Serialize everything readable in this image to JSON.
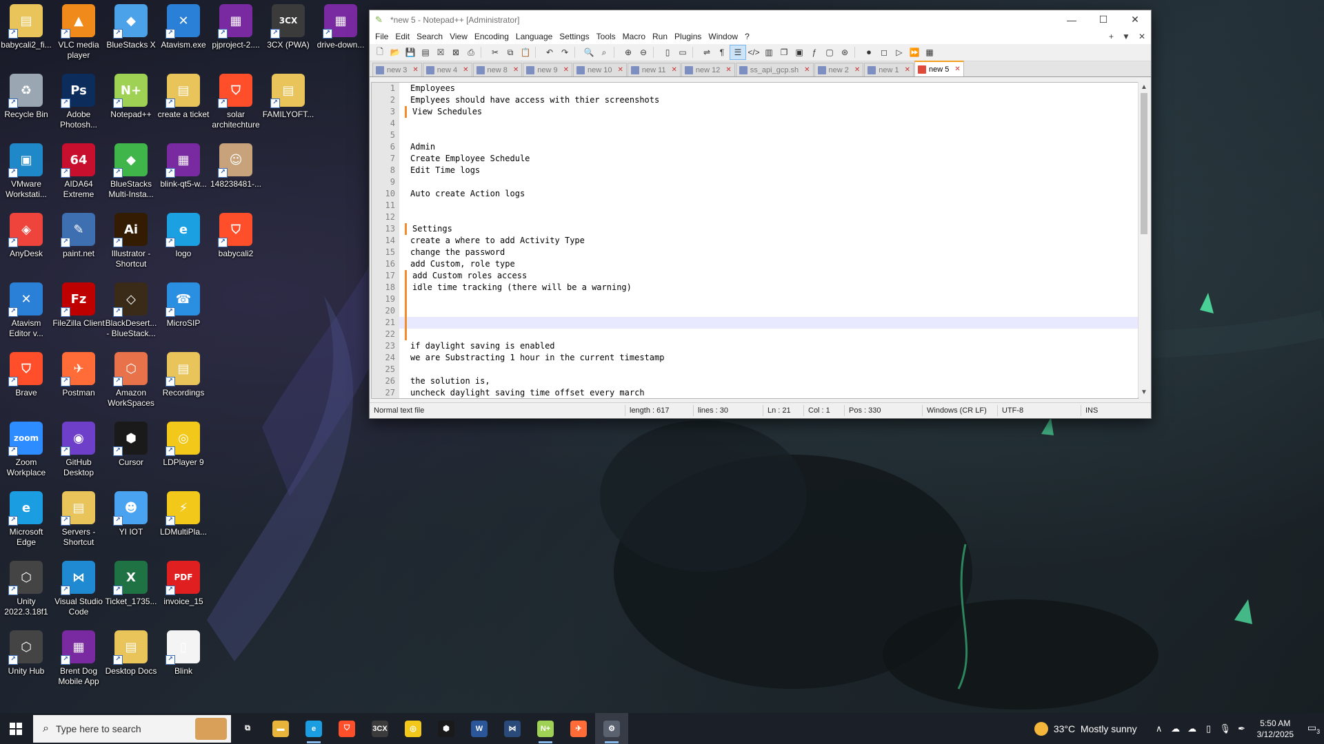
{
  "desktop": {
    "icons": [
      {
        "label": "babycali2_fi...",
        "color": "#e8c45a",
        "glyph": "▤"
      },
      {
        "label": "VLC media player",
        "color": "#f08a1a",
        "glyph": "▲"
      },
      {
        "label": "BlueStacks X",
        "color": "#4ba2e8",
        "glyph": "◆"
      },
      {
        "label": "Atavism.exe",
        "color": "#2a7fd6",
        "glyph": "✕"
      },
      {
        "label": "pjproject-2....",
        "color": "#7a2aa0",
        "glyph": "▦"
      },
      {
        "label": "3CX (PWA)",
        "color": "#3b3b3b",
        "glyph": "3CX"
      },
      {
        "label": "drive-down...",
        "color": "#7a2aa0",
        "glyph": "▦"
      },
      {
        "label": "Recycle Bin",
        "color": "#9aa7b2",
        "glyph": "♻"
      },
      {
        "label": "Adobe Photosh...",
        "color": "#0c2d5c",
        "glyph": "Ps"
      },
      {
        "label": "Notepad++",
        "color": "#9fd154",
        "glyph": "N+"
      },
      {
        "label": "create a ticket",
        "color": "#e8c45a",
        "glyph": "▤"
      },
      {
        "label": "solar architechture",
        "color": "#ff4f2a",
        "glyph": "⛉"
      },
      {
        "label": "FAMILYOFT...",
        "color": "#e8c45a",
        "glyph": "▤"
      },
      {
        "label": "VMware Workstati...",
        "color": "#1f88c9",
        "glyph": "▣"
      },
      {
        "label": "AIDA64 Extreme",
        "color": "#c8102e",
        "glyph": "64"
      },
      {
        "label": "BlueStacks Multi-Insta...",
        "color": "#3fb54a",
        "glyph": "◆"
      },
      {
        "label": "blink-qt5-w...",
        "color": "#7a2aa0",
        "glyph": "▦"
      },
      {
        "label": "148238481-...",
        "color": "#c8a27a",
        "glyph": "☺"
      },
      {
        "label": "AnyDesk",
        "color": "#ef443b",
        "glyph": "◈"
      },
      {
        "label": "paint.net",
        "color": "#3e6fb0",
        "glyph": "✎"
      },
      {
        "label": "Illustrator - Shortcut",
        "color": "#331c02",
        "glyph": "Ai"
      },
      {
        "label": "logo",
        "color": "#1ba1e2",
        "glyph": "e"
      },
      {
        "label": "babycali2",
        "color": "#ff4f2a",
        "glyph": "⛉"
      },
      {
        "label": "Atavism Editor v...",
        "color": "#2a7fd6",
        "glyph": "✕"
      },
      {
        "label": "FileZilla Client",
        "color": "#bf0000",
        "glyph": "Fz"
      },
      {
        "label": "BlackDesert... - BlueStack...",
        "color": "#3a2a18",
        "glyph": "◇"
      },
      {
        "label": "MicroSIP",
        "color": "#2a8fe0",
        "glyph": "☎"
      },
      {
        "label": "Brave",
        "color": "#ff4f2a",
        "glyph": "⛉"
      },
      {
        "label": "Postman",
        "color": "#ff6c37",
        "glyph": "✈"
      },
      {
        "label": "Amazon WorkSpaces",
        "color": "#e8734a",
        "glyph": "⬡"
      },
      {
        "label": "Recordings",
        "color": "#e8c45a",
        "glyph": "▤"
      },
      {
        "label": "Zoom Workplace",
        "color": "#2d8cff",
        "glyph": "zoom"
      },
      {
        "label": "GitHub Desktop",
        "color": "#6e40c9",
        "glyph": "◉"
      },
      {
        "label": "Cursor",
        "color": "#1a1a1a",
        "glyph": "⬢"
      },
      {
        "label": "LDPlayer 9",
        "color": "#f2c81a",
        "glyph": "◎"
      },
      {
        "label": "Microsoft Edge",
        "color": "#1b9de2",
        "glyph": "e"
      },
      {
        "label": "Servers - Shortcut",
        "color": "#e8c45a",
        "glyph": "▤"
      },
      {
        "label": "YI IOT",
        "color": "#4aa3f0",
        "glyph": "☻"
      },
      {
        "label": "LDMultiPla...",
        "color": "#f2c81a",
        "glyph": "⚡"
      },
      {
        "label": "Unity 2022.3.18f1",
        "color": "#444",
        "glyph": "⬡"
      },
      {
        "label": "Visual Studio Code",
        "color": "#1f8ad2",
        "glyph": "⋈"
      },
      {
        "label": "Ticket_1735...",
        "color": "#1f7244",
        "glyph": "X"
      },
      {
        "label": "invoice_15",
        "color": "#e02020",
        "glyph": "PDF"
      },
      {
        "label": "Unity Hub",
        "color": "#444",
        "glyph": "⬡"
      },
      {
        "label": "Brent Dog Mobile App",
        "color": "#7a2aa0",
        "glyph": "▦"
      },
      {
        "label": "Desktop Docs",
        "color": "#e8c45a",
        "glyph": "▤"
      },
      {
        "label": "Blink",
        "color": "#f4f4f4",
        "glyph": "▯"
      }
    ]
  },
  "window": {
    "title": "*new 5 - Notepad++ [Administrator]",
    "menu": [
      "File",
      "Edit",
      "Search",
      "View",
      "Encoding",
      "Language",
      "Settings",
      "Tools",
      "Macro",
      "Run",
      "Plugins",
      "Window",
      "?"
    ],
    "menu_right": [
      "+",
      "▼",
      "✕"
    ],
    "tabs": [
      {
        "label": "new 3",
        "active": false
      },
      {
        "label": "new 4",
        "active": false
      },
      {
        "label": "new 8",
        "active": false
      },
      {
        "label": "new 9",
        "active": false
      },
      {
        "label": "new 10",
        "active": false
      },
      {
        "label": "new 11",
        "active": false
      },
      {
        "label": "new 12",
        "active": false
      },
      {
        "label": "ss_api_gcp.sh",
        "active": false
      },
      {
        "label": "new 2",
        "active": false
      },
      {
        "label": "new 1",
        "active": false
      },
      {
        "label": "new 5",
        "active": true
      }
    ],
    "lines": [
      {
        "n": "1",
        "text": "Employees",
        "changed": false
      },
      {
        "n": "2",
        "text": "Emplyees should have access with thier screenshots",
        "changed": false
      },
      {
        "n": "3",
        "text": "View Schedules",
        "changed": true
      },
      {
        "n": "4",
        "text": "",
        "changed": false
      },
      {
        "n": "5",
        "text": "",
        "changed": false
      },
      {
        "n": "6",
        "text": "Admin",
        "changed": false
      },
      {
        "n": "7",
        "text": "Create Employee Schedule",
        "changed": false
      },
      {
        "n": "8",
        "text": "Edit Time logs",
        "changed": false
      },
      {
        "n": "9",
        "text": "",
        "changed": false
      },
      {
        "n": "10",
        "text": "Auto create Action logs",
        "changed": false
      },
      {
        "n": "11",
        "text": "",
        "changed": false
      },
      {
        "n": "12",
        "text": "",
        "changed": false
      },
      {
        "n": "13",
        "text": "Settings",
        "changed": true
      },
      {
        "n": "14",
        "text": "create a where to add Activity Type",
        "changed": false
      },
      {
        "n": "15",
        "text": "change the password",
        "changed": false
      },
      {
        "n": "16",
        "text": "add Custom, role type",
        "changed": false
      },
      {
        "n": "17",
        "text": "add Custom roles access",
        "changed": true
      },
      {
        "n": "18",
        "text": "idle time tracking (there will be a warning)",
        "changed": true
      },
      {
        "n": "19",
        "text": "",
        "changed": true
      },
      {
        "n": "20",
        "text": "",
        "changed": true
      },
      {
        "n": "21",
        "text": "",
        "changed": true,
        "current": true
      },
      {
        "n": "22",
        "text": "",
        "changed": true
      },
      {
        "n": "23",
        "text": "if daylight saving is enabled",
        "changed": false
      },
      {
        "n": "24",
        "text": "we are Substracting 1 hour in the current timestamp",
        "changed": false
      },
      {
        "n": "25",
        "text": "",
        "changed": false
      },
      {
        "n": "26",
        "text": "the solution is,",
        "changed": false
      },
      {
        "n": "27",
        "text": "uncheck daylight saving time offset every march",
        "changed": false
      }
    ],
    "status": {
      "type": "Normal text file",
      "length": "length : 617",
      "lines": "lines : 30",
      "ln": "Ln : 21",
      "col": "Col : 1",
      "pos": "Pos : 330",
      "eol": "Windows (CR LF)",
      "encoding": "UTF-8",
      "mode": "INS"
    }
  },
  "taskbar": {
    "search_placeholder": "Type here to search",
    "weather_temp": "33°C",
    "weather_text": "Mostly sunny",
    "time": "5:50 AM",
    "date": "3/12/2025",
    "notification_count": "3",
    "apps": [
      {
        "name": "task-view",
        "color": "#1b1f27",
        "glyph": "⧉",
        "running": false
      },
      {
        "name": "file-explorer",
        "color": "#e8b53a",
        "glyph": "▬",
        "running": false
      },
      {
        "name": "edge",
        "color": "#1b9de2",
        "glyph": "e",
        "running": true
      },
      {
        "name": "brave",
        "color": "#ff4f2a",
        "glyph": "⛉",
        "running": false
      },
      {
        "name": "3cx",
        "color": "#3b3b3b",
        "glyph": "3CX",
        "running": false
      },
      {
        "name": "ldplayer",
        "color": "#f2c81a",
        "glyph": "◎",
        "running": false
      },
      {
        "name": "cursor",
        "color": "#1a1a1a",
        "glyph": "⬢",
        "running": false
      },
      {
        "name": "word",
        "color": "#2b579a",
        "glyph": "W",
        "running": false
      },
      {
        "name": "ide",
        "color": "#2a4a7a",
        "glyph": "⋈",
        "running": false
      },
      {
        "name": "notepad-plus-plus",
        "color": "#9fd154",
        "glyph": "N+",
        "running": true
      },
      {
        "name": "postman",
        "color": "#ff6c37",
        "glyph": "✈",
        "running": false
      },
      {
        "name": "settings",
        "color": "#5a6270",
        "glyph": "⚙",
        "running": true
      }
    ]
  }
}
